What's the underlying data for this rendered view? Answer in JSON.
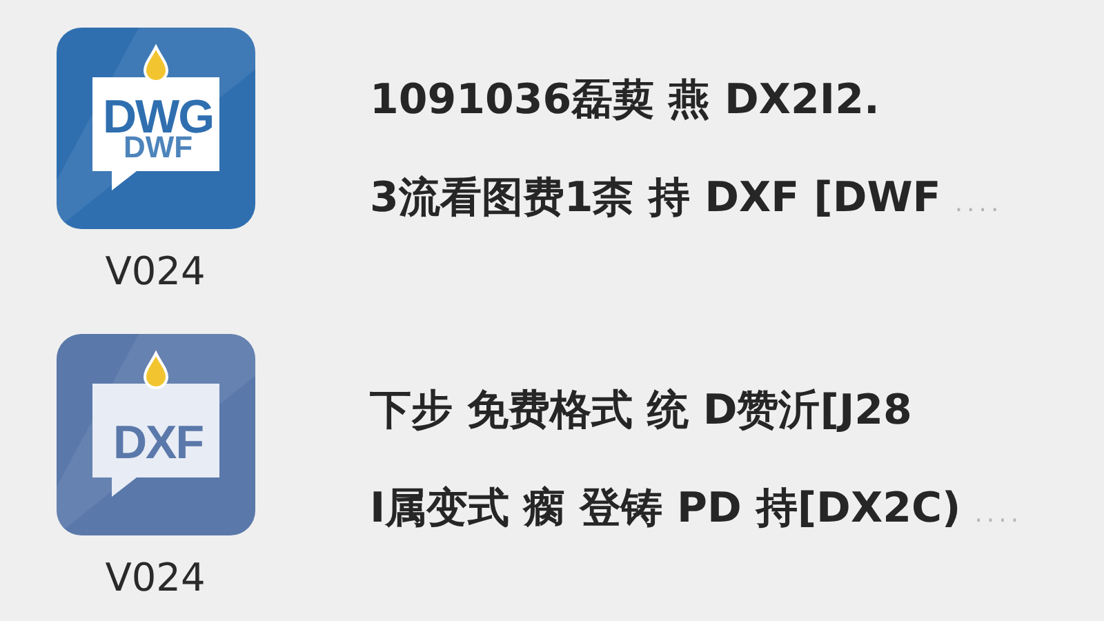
{
  "apps": [
    {
      "icon": {
        "kind": "dwg",
        "labels": [
          "DWG",
          "DWF"
        ]
      },
      "version": "V024",
      "lines": [
        "1091036磊葜 燕 DX2I2.",
        "3流看图费1柰 持 DXF [DWF"
      ],
      "more": "...."
    },
    {
      "icon": {
        "kind": "dxf",
        "labels": [
          "DXF"
        ]
      },
      "version": "V024",
      "lines": [
        "下步 免费格式 统 D赞沂[J28",
        "I属变式 瘸 登铸 PD 持[DX2C)"
      ],
      "more": "...."
    }
  ]
}
